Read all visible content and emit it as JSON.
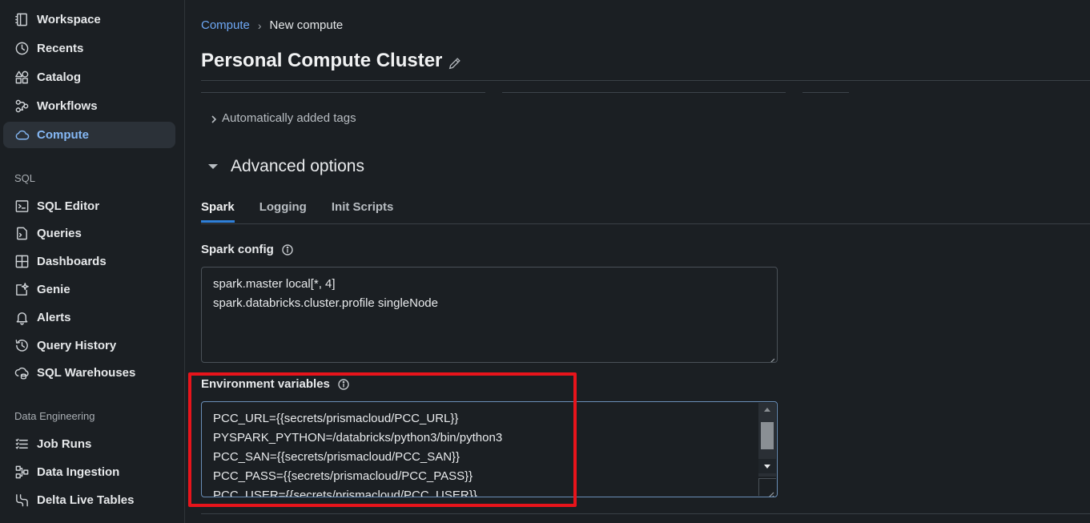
{
  "sidebar": {
    "items": [
      {
        "label": "Workspace",
        "icon": "workspace-icon"
      },
      {
        "label": "Recents",
        "icon": "clock-icon"
      },
      {
        "label": "Catalog",
        "icon": "catalog-icon"
      },
      {
        "label": "Workflows",
        "icon": "workflows-icon"
      },
      {
        "label": "Compute",
        "icon": "cloud-icon",
        "active": true
      }
    ],
    "sql_heading": "SQL",
    "sql_items": [
      {
        "label": "SQL Editor",
        "icon": "sql-editor-icon"
      },
      {
        "label": "Queries",
        "icon": "queries-icon"
      },
      {
        "label": "Dashboards",
        "icon": "dashboards-icon"
      },
      {
        "label": "Genie",
        "icon": "genie-icon"
      },
      {
        "label": "Alerts",
        "icon": "bell-icon"
      },
      {
        "label": "Query History",
        "icon": "history-icon"
      },
      {
        "label": "SQL Warehouses",
        "icon": "warehouse-icon"
      }
    ],
    "de_heading": "Data Engineering",
    "de_items": [
      {
        "label": "Job Runs",
        "icon": "job-runs-icon"
      },
      {
        "label": "Data Ingestion",
        "icon": "ingestion-icon"
      },
      {
        "label": "Delta Live Tables",
        "icon": "dlt-icon"
      }
    ]
  },
  "breadcrumb": {
    "parent": "Compute",
    "separator": "›",
    "current": "New compute"
  },
  "page_title": "Personal Compute Cluster",
  "auto_tags_label": "Automatically added tags",
  "advanced_label": "Advanced options",
  "tabs": [
    {
      "label": "Spark",
      "active": true
    },
    {
      "label": "Logging"
    },
    {
      "label": "Init Scripts"
    }
  ],
  "spark_config": {
    "label": "Spark config",
    "lines": [
      "spark.master local[*, 4]",
      "spark.databricks.cluster.profile singleNode"
    ]
  },
  "env_vars": {
    "label": "Environment variables",
    "lines": [
      "PCC_URL={{secrets/prismacloud/PCC_URL}}",
      "PYSPARK_PYTHON=/databricks/python3/bin/python3",
      "PCC_SAN={{secrets/prismacloud/PCC_SAN}}",
      "PCC_PASS={{secrets/prismacloud/PCC_PASS}}",
      "PCC_USER={{secrets/prismacloud/PCC_USER}}"
    ]
  },
  "colors": {
    "accent": "#2f80d9",
    "link": "#6ea8f5",
    "highlight": "#e8141b",
    "background": "#1b1f23"
  }
}
